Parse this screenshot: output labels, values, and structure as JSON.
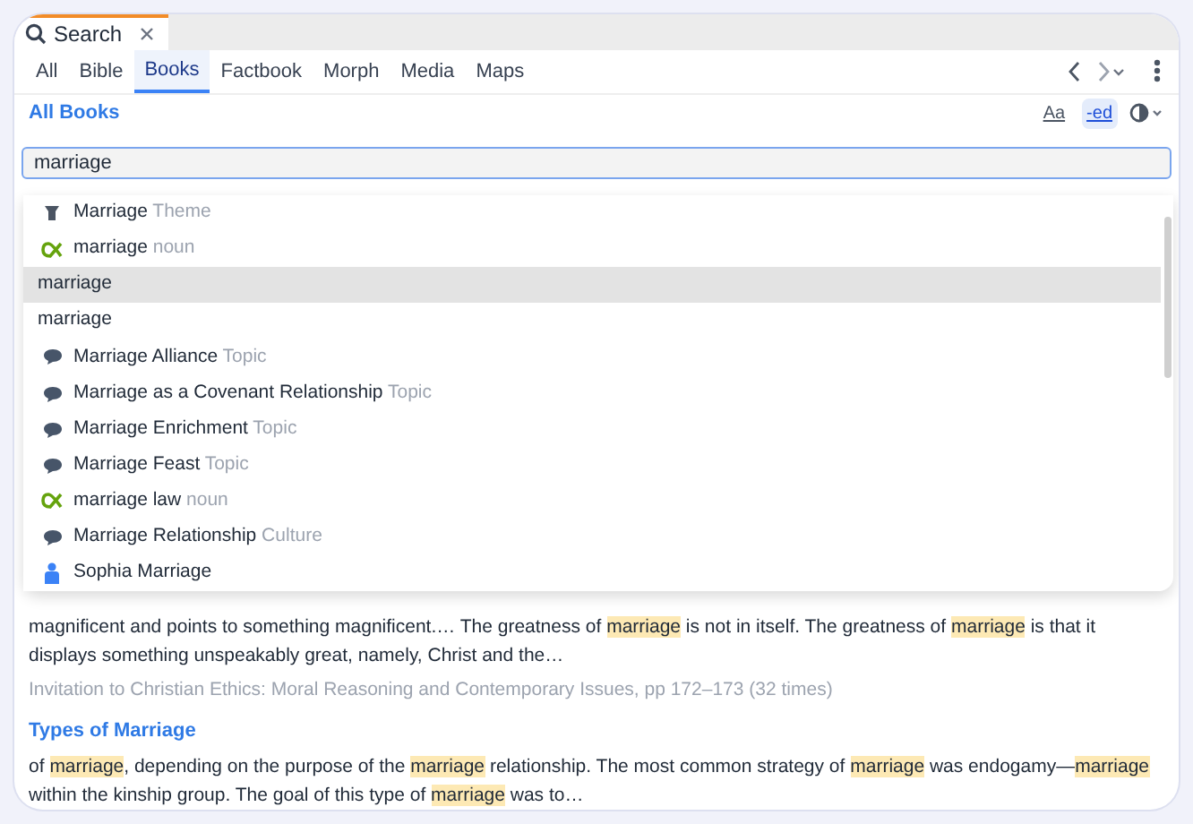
{
  "tab": {
    "title": "Search"
  },
  "filters": [
    {
      "label": "All",
      "selected": false
    },
    {
      "label": "Bible",
      "selected": false
    },
    {
      "label": "Books",
      "selected": true
    },
    {
      "label": "Factbook",
      "selected": false
    },
    {
      "label": "Morph",
      "selected": false
    },
    {
      "label": "Media",
      "selected": false
    },
    {
      "label": "Maps",
      "selected": false
    }
  ],
  "scope": "All Books",
  "options": [
    {
      "label": "Aa",
      "selected": false
    },
    {
      "label": "-ed",
      "selected": true
    }
  ],
  "search": {
    "value": "marriage"
  },
  "suggestions": [
    {
      "kind": "theme",
      "label": "Marriage",
      "type": "Theme",
      "selected": false
    },
    {
      "kind": "lemma",
      "label": "marriage",
      "type": "noun",
      "selected": false
    },
    {
      "kind": "plain",
      "label": "marriage",
      "selected": true
    },
    {
      "kind": "plain",
      "label": "marriage",
      "selected": false
    },
    {
      "kind": "topic",
      "label": "Marriage Alliance",
      "type": "Topic",
      "selected": false
    },
    {
      "kind": "topic",
      "label": "Marriage as a Covenant Relationship",
      "type": "Topic",
      "selected": false
    },
    {
      "kind": "topic",
      "label": "Marriage Enrichment",
      "type": "Topic",
      "selected": false
    },
    {
      "kind": "topic",
      "label": "Marriage Feast",
      "type": "Topic",
      "selected": false
    },
    {
      "kind": "lemma",
      "label": "marriage law",
      "type": "noun",
      "selected": false
    },
    {
      "kind": "topic",
      "label": "Marriage Relationship",
      "type": "Culture",
      "selected": false
    },
    {
      "kind": "person",
      "label": "Sophia Marriage",
      "selected": false
    }
  ],
  "results": [
    {
      "snippet": [
        {
          "text": "magnificent and points to something magnificent.… The greatness of ",
          "highlight": false
        },
        {
          "text": "marriage",
          "highlight": true
        },
        {
          "text": " is not in itself. The greatness of ",
          "highlight": false
        },
        {
          "text": "marriage",
          "highlight": true
        },
        {
          "text": " is that it displays something unspeakably great, namely, Christ and the…",
          "highlight": false
        }
      ],
      "source": "Invitation to Christian Ethics: Moral Reasoning and Contemporary Issues, pp 172–173 (32 times)"
    },
    {
      "heading": "Types of Marriage",
      "snippet": [
        {
          "text": "of ",
          "highlight": false
        },
        {
          "text": "marriage",
          "highlight": true
        },
        {
          "text": ", depending on the purpose of the ",
          "highlight": false
        },
        {
          "text": "marriage",
          "highlight": true
        },
        {
          "text": " relationship. The most common strategy of ",
          "highlight": false
        },
        {
          "text": "marriage",
          "highlight": true
        },
        {
          "text": " was endogamy—",
          "highlight": false
        },
        {
          "text": "marriage",
          "highlight": true
        },
        {
          "text": " within the kinship group. The goal of this type of ",
          "highlight": false
        },
        {
          "text": "marriage",
          "highlight": true
        },
        {
          "text": " was to…",
          "highlight": false
        }
      ]
    }
  ]
}
